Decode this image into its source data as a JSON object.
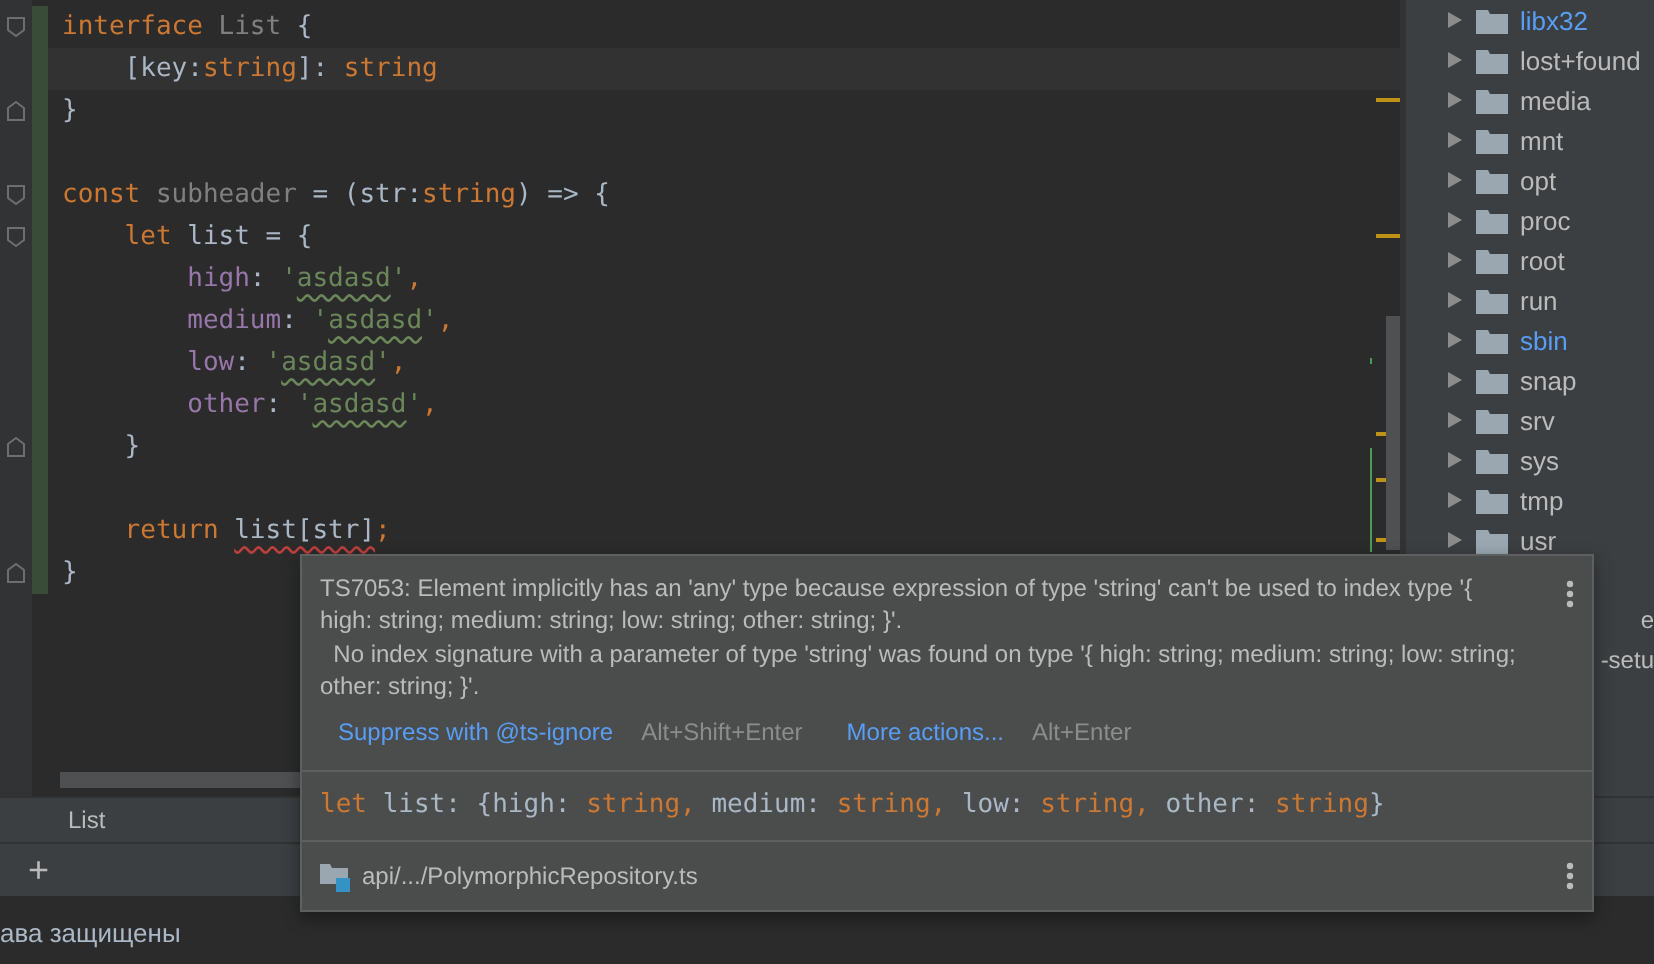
{
  "editor": {
    "lines": [
      {
        "fold_open": true,
        "fold_close": false,
        "changed": true,
        "current": false,
        "tokens": [
          {
            "kind": "keyword",
            "text": "interface "
          },
          {
            "kind": "unused",
            "text": "List"
          },
          {
            "kind": "plain",
            "text": " {"
          }
        ]
      },
      {
        "fold_open": false,
        "fold_close": false,
        "changed": true,
        "current": true,
        "tokens": [
          {
            "kind": "plain",
            "text": "    [key:"
          },
          {
            "kind": "type",
            "text": "string"
          },
          {
            "kind": "plain",
            "text": "]: "
          },
          {
            "kind": "type",
            "text": "string"
          }
        ]
      },
      {
        "fold_open": false,
        "fold_close": true,
        "changed": true,
        "current": false,
        "tokens": [
          {
            "kind": "plain",
            "text": "}"
          }
        ]
      },
      {
        "fold_open": false,
        "fold_close": false,
        "changed": true,
        "current": false
      },
      {
        "fold_open": true,
        "fold_close": false,
        "changed": true,
        "current": false,
        "tokens": [
          {
            "kind": "keyword",
            "text": "const "
          },
          {
            "kind": "unused",
            "text": "subheader"
          },
          {
            "kind": "plain",
            "text": " = (str:"
          },
          {
            "kind": "type",
            "text": "string"
          },
          {
            "kind": "plain",
            "text": ") => {"
          }
        ]
      },
      {
        "fold_open": true,
        "fold_close": false,
        "changed": true,
        "current": false,
        "tokens": [
          {
            "kind": "keyword",
            "text": "    let "
          },
          {
            "kind": "plain",
            "text": "list = {"
          }
        ]
      },
      {
        "fold_open": false,
        "fold_close": false,
        "changed": true,
        "current": false,
        "tokens": [
          {
            "kind": "property",
            "text": "        high"
          },
          {
            "kind": "plain",
            "text": ": "
          },
          {
            "kind": "string",
            "text": "'"
          },
          {
            "kind": "string",
            "text": "asdasd",
            "misspelled": true
          },
          {
            "kind": "string",
            "text": "'"
          },
          {
            "kind": "keyword",
            "text": ","
          }
        ]
      },
      {
        "fold_open": false,
        "fold_close": false,
        "changed": true,
        "current": false,
        "tokens": [
          {
            "kind": "property",
            "text": "        medium"
          },
          {
            "kind": "plain",
            "text": ": "
          },
          {
            "kind": "string",
            "text": "'"
          },
          {
            "kind": "string",
            "text": "asdasd",
            "misspelled": true
          },
          {
            "kind": "string",
            "text": "'"
          },
          {
            "kind": "keyword",
            "text": ","
          }
        ]
      },
      {
        "fold_open": false,
        "fold_close": false,
        "changed": true,
        "current": false,
        "tokens": [
          {
            "kind": "property",
            "text": "        low"
          },
          {
            "kind": "plain",
            "text": ": "
          },
          {
            "kind": "string",
            "text": "'"
          },
          {
            "kind": "string",
            "text": "asdasd",
            "misspelled": true
          },
          {
            "kind": "string",
            "text": "'"
          },
          {
            "kind": "keyword",
            "text": ","
          }
        ]
      },
      {
        "fold_open": false,
        "fold_close": false,
        "changed": true,
        "current": false,
        "tokens": [
          {
            "kind": "property",
            "text": "        other"
          },
          {
            "kind": "plain",
            "text": ": "
          },
          {
            "kind": "string",
            "text": "'"
          },
          {
            "kind": "string",
            "text": "asdasd",
            "misspelled": true
          },
          {
            "kind": "string",
            "text": "'"
          },
          {
            "kind": "keyword",
            "text": ","
          }
        ]
      },
      {
        "fold_open": false,
        "fold_close": true,
        "changed": true,
        "current": false,
        "tokens": [
          {
            "kind": "plain",
            "text": "    }"
          }
        ]
      },
      {
        "fold_open": false,
        "fold_close": false,
        "changed": true,
        "current": false
      },
      {
        "fold_open": false,
        "fold_close": false,
        "changed": true,
        "current": false,
        "tokens": [
          {
            "kind": "keyword",
            "text": "    return "
          },
          {
            "kind": "plain",
            "text": "list[str]",
            "error": true
          },
          {
            "kind": "keyword",
            "text": ";"
          }
        ]
      },
      {
        "fold_open": false,
        "fold_close": true,
        "changed": true,
        "current": false,
        "tokens": [
          {
            "kind": "plain",
            "text": "}"
          }
        ]
      }
    ]
  },
  "project_tree": {
    "items": [
      {
        "kind": "folder",
        "name": "libx32",
        "highlighted": true
      },
      {
        "kind": "folder",
        "name": "lost+found",
        "highlighted": false
      },
      {
        "kind": "folder",
        "name": "media",
        "highlighted": false
      },
      {
        "kind": "folder",
        "name": "mnt",
        "highlighted": false
      },
      {
        "kind": "folder",
        "name": "opt",
        "highlighted": false
      },
      {
        "kind": "folder",
        "name": "proc",
        "highlighted": false
      },
      {
        "kind": "folder",
        "name": "root",
        "highlighted": false
      },
      {
        "kind": "folder",
        "name": "run",
        "highlighted": false
      },
      {
        "kind": "folder",
        "name": "sbin",
        "highlighted": true
      },
      {
        "kind": "folder",
        "name": "snap",
        "highlighted": false
      },
      {
        "kind": "folder",
        "name": "srv",
        "highlighted": false
      },
      {
        "kind": "folder",
        "name": "sys",
        "highlighted": false
      },
      {
        "kind": "folder",
        "name": "tmp",
        "highlighted": false
      },
      {
        "kind": "folder",
        "name": "usr",
        "highlighted": false
      },
      {
        "kind": "cut",
        "name": "e",
        "highlighted": false
      },
      {
        "kind": "cut",
        "name": "-setu",
        "highlighted": false
      }
    ]
  },
  "popup": {
    "message": "TS7053: Element implicitly has an 'any' type because expression of type 'string' can't be used to index type '{ high: string; medium: string; low: string; other: string; }'.\n  No index signature with a parameter of type 'string' was found on type '{ high: string; medium: string; low: string; other: string; }'.",
    "actions": [
      {
        "label": "Suppress with @ts-ignore",
        "shortcut": "Alt+Shift+Enter"
      },
      {
        "label": "More actions...",
        "shortcut": "Alt+Enter"
      }
    ],
    "type_signature": [
      {
        "kind": "keyword",
        "text": "let "
      },
      {
        "kind": "plain",
        "text": "list: {high: "
      },
      {
        "kind": "keyword",
        "text": "string, "
      },
      {
        "kind": "plain",
        "text": "medium: "
      },
      {
        "kind": "keyword",
        "text": "string, "
      },
      {
        "kind": "plain",
        "text": "low: "
      },
      {
        "kind": "keyword",
        "text": "string, "
      },
      {
        "kind": "plain",
        "text": "other: "
      },
      {
        "kind": "keyword",
        "text": "string"
      },
      {
        "kind": "plain",
        "text": "}"
      }
    ],
    "file": "api/.../PolymorphicRepository.ts"
  },
  "tool_window": {
    "title": "List",
    "add_button": "+"
  },
  "console": {
    "text": "ава защищены"
  }
}
